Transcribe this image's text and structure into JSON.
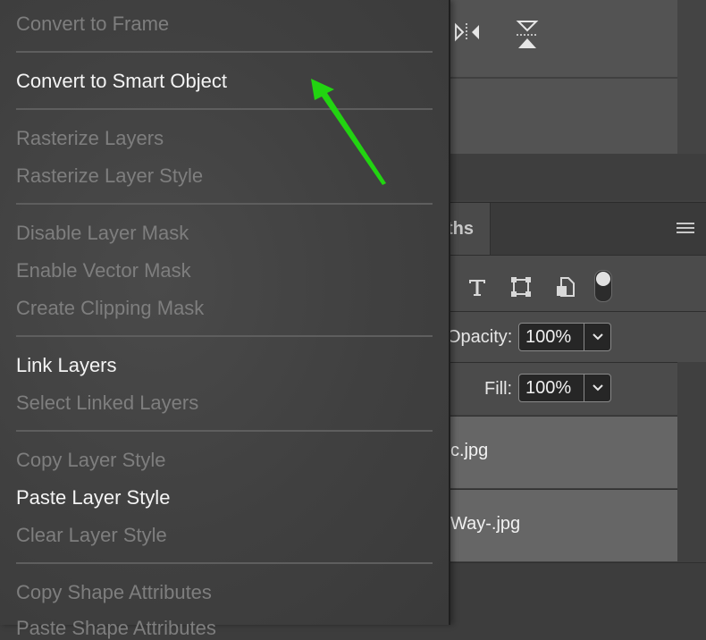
{
  "menu": {
    "items": [
      {
        "label": "Convert to Frame",
        "enabled": false
      },
      {
        "label": "Convert to Smart Object",
        "enabled": true
      },
      {
        "label": "Rasterize Layers",
        "enabled": false
      },
      {
        "label": "Rasterize Layer Style",
        "enabled": false
      },
      {
        "label": "Disable Layer Mask",
        "enabled": false
      },
      {
        "label": "Enable Vector Mask",
        "enabled": false
      },
      {
        "label": "Create Clipping Mask",
        "enabled": false
      },
      {
        "label": "Link Layers",
        "enabled": true
      },
      {
        "label": "Select Linked Layers",
        "enabled": false
      },
      {
        "label": "Copy Layer Style",
        "enabled": false
      },
      {
        "label": "Paste Layer Style",
        "enabled": true
      },
      {
        "label": "Clear Layer Style",
        "enabled": false
      },
      {
        "label": "Copy Shape Attributes",
        "enabled": false
      },
      {
        "label": "Paste Shape Attributes",
        "enabled": false
      }
    ]
  },
  "panel": {
    "tab_partial": "ths",
    "opacity_label": "Opacity:",
    "opacity_value": "100%",
    "fill_label": "Fill:",
    "fill_value": "100%",
    "layers": [
      {
        "name_partial": "c.jpg"
      },
      {
        "name_partial": "Way-.jpg"
      }
    ]
  },
  "icons": {
    "distribute_horizontal": "distribute-horizontal-icon",
    "distribute_vertical": "distribute-vertical-icon",
    "filter_type": "type-filter-icon",
    "filter_shape": "shape-filter-icon",
    "filter_smart": "smart-object-filter-icon",
    "panel_menu": "hamburger-icon"
  },
  "colors": {
    "annotation_arrow": "#22d411",
    "menu_enabled_text": "#f4f4f4",
    "menu_disabled_text": "#7e7e7e"
  }
}
